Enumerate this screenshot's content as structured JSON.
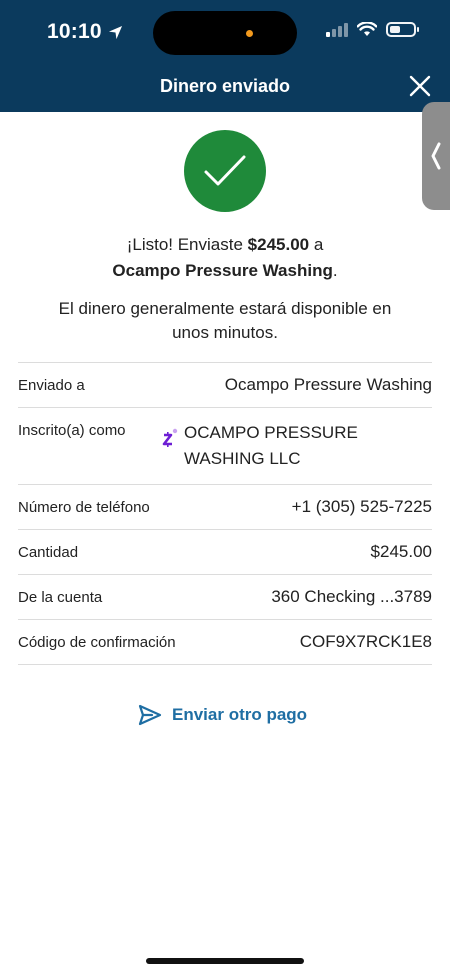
{
  "status_bar": {
    "time": "10:10"
  },
  "header": {
    "title": "Dinero enviado"
  },
  "confirmation": {
    "line1_prefix": "¡Listo! Enviaste ",
    "amount": "$245.00",
    "line1_suffix": " a",
    "recipient": "Ocampo Pressure Washing",
    "recipient_suffix": ".",
    "availability": "El dinero generalmente estará disponible en unos minutos."
  },
  "details": {
    "sent_to": {
      "label": "Enviado a",
      "value": "Ocampo Pressure Washing"
    },
    "enrolled_as": {
      "label": "Inscrito(a) como",
      "value": "OCAMPO PRESSURE WASHING LLC"
    },
    "phone": {
      "label": "Número de teléfono",
      "value": "+1 (305) 525-7225"
    },
    "amount": {
      "label": "Cantidad",
      "value": "$245.00"
    },
    "from_account": {
      "label": "De la cuenta",
      "value": "360 Checking ...3789"
    },
    "confirmation_code": {
      "label": "Código de confirmación",
      "value": "COF9X7RCK1E8"
    }
  },
  "actions": {
    "send_another": "Enviar otro pago"
  },
  "colors": {
    "header_bg": "#0b3a5d",
    "success_green": "#1f8a3a",
    "link_blue": "#1f6ea3"
  },
  "icons": [
    "location-arrow-icon",
    "signal-icon",
    "wifi-icon",
    "battery-icon",
    "close-icon",
    "chevron-left-icon",
    "checkmark-icon",
    "zelle-icon",
    "send-icon"
  ]
}
